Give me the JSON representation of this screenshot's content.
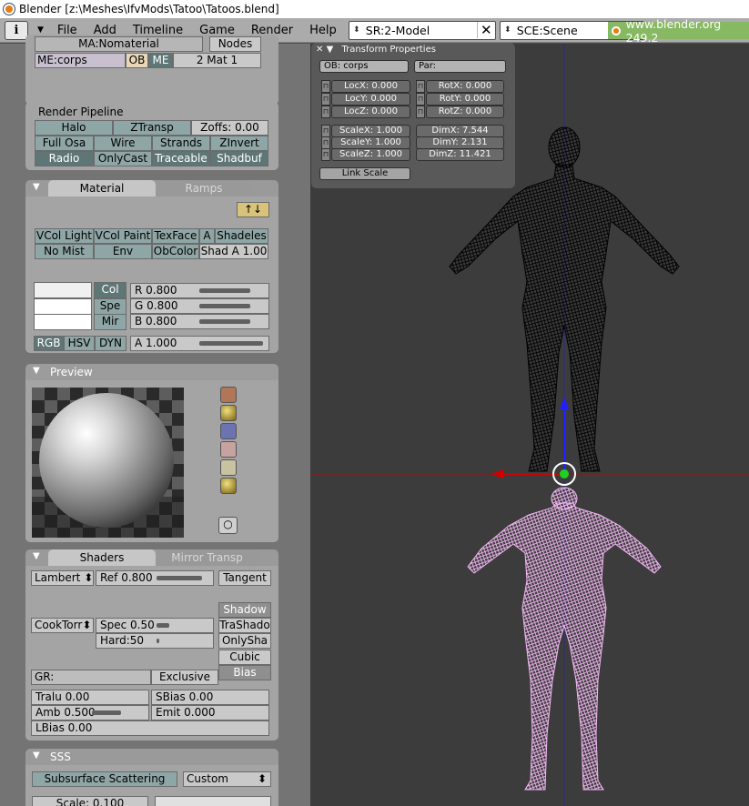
{
  "window_title": "Blender [z:\\Meshes\\IfvMods\\Tatoo\\Tatoos.blend]",
  "menu": {
    "items": [
      "File",
      "Add",
      "Timeline",
      "Game",
      "Render",
      "Help"
    ]
  },
  "editor_select": "i",
  "screen_select": "SR:2-Model",
  "scene_select": "SCE:Scene",
  "site": "www.blender.org 249.2",
  "top": {
    "mat_name": "MA:Nomaterial",
    "nodes": "Nodes",
    "me_field": "ME:corps",
    "ob": "OB",
    "me": "ME",
    "mat_count": "2 Mat 1"
  },
  "render_pipeline": {
    "title": "Render Pipeline",
    "halo": "Halo",
    "ztransp": "ZTransp",
    "zoffs": "Zoffs: 0.00",
    "fullosa": "Full Osa",
    "wire": "Wire",
    "strands": "Strands",
    "zinvert": "ZInvert",
    "radio": "Radio",
    "onlycast": "OnlyCast",
    "traceable": "Traceable",
    "shadbuf": "Shadbuf"
  },
  "material": {
    "tab": "Material",
    "tab2": "Ramps",
    "vcol_light": "VCol Light",
    "vcol_paint": "VCol Paint",
    "texface": "TexFace",
    "a": "A",
    "shadeless": "Shadeles",
    "nomist": "No Mist",
    "env": "Env",
    "obcolor": "ObColor",
    "shad_a": "Shad A 1.00",
    "col": "Col",
    "spe": "Spe",
    "mir": "Mir",
    "r": "R 0.800",
    "g": "G 0.800",
    "b": "B 0.800",
    "alpha": "A 1.000",
    "rgb": "RGB",
    "hsv": "HSV",
    "dyn": "DYN"
  },
  "preview": {
    "title": "Preview"
  },
  "shaders": {
    "tab": "Shaders",
    "tab2": "Mirror Transp",
    "lambert": "Lambert",
    "ref": "Ref   0.800",
    "tangent": "Tangent",
    "shadow": "Shadow",
    "cooktorr": "CookTorr",
    "spec": "Spec 0.50",
    "trashado": "TraShado",
    "hard": "Hard:50",
    "onlysha": "OnlySha",
    "cubic": "Cubic",
    "gr": "GR:",
    "exclusive": "Exclusive",
    "bias": "Bias",
    "tralu": "Tralu 0.00",
    "sbias": "SBias 0.00",
    "amb": "Amb 0.500",
    "emit": "Emit 0.000",
    "lbias": "LBias 0.00"
  },
  "sss": {
    "title": "SSS",
    "button": "Subsurface Scattering",
    "preset": "Custom",
    "scale": "Scale: 0.100"
  },
  "transform": {
    "title": "Transform Properties",
    "ob": "OB: corps",
    "par": "Par:",
    "locx": "LocX: 0.000",
    "locy": "LocY: 0.000",
    "locz": "LocZ: 0.000",
    "rotx": "RotX: 0.000",
    "roty": "RotY: 0.000",
    "rotz": "RotZ: 0.000",
    "scalex": "ScaleX: 1.000",
    "scaley": "ScaleY: 1.000",
    "scalez": "ScaleZ: 1.000",
    "dimx": "DimX: 7.544",
    "dimy": "DimY: 2.131",
    "dimz": "DimZ: 11.421",
    "linkscale": "Link Scale"
  },
  "colors": {
    "bg": "#4e4e4e",
    "viewport": "#3c3c3c",
    "wire_black": "#0a0a0a",
    "wire_pink": "#f2b6f2",
    "axis_red": "#c00000",
    "axis_blue": "#2020ff"
  }
}
